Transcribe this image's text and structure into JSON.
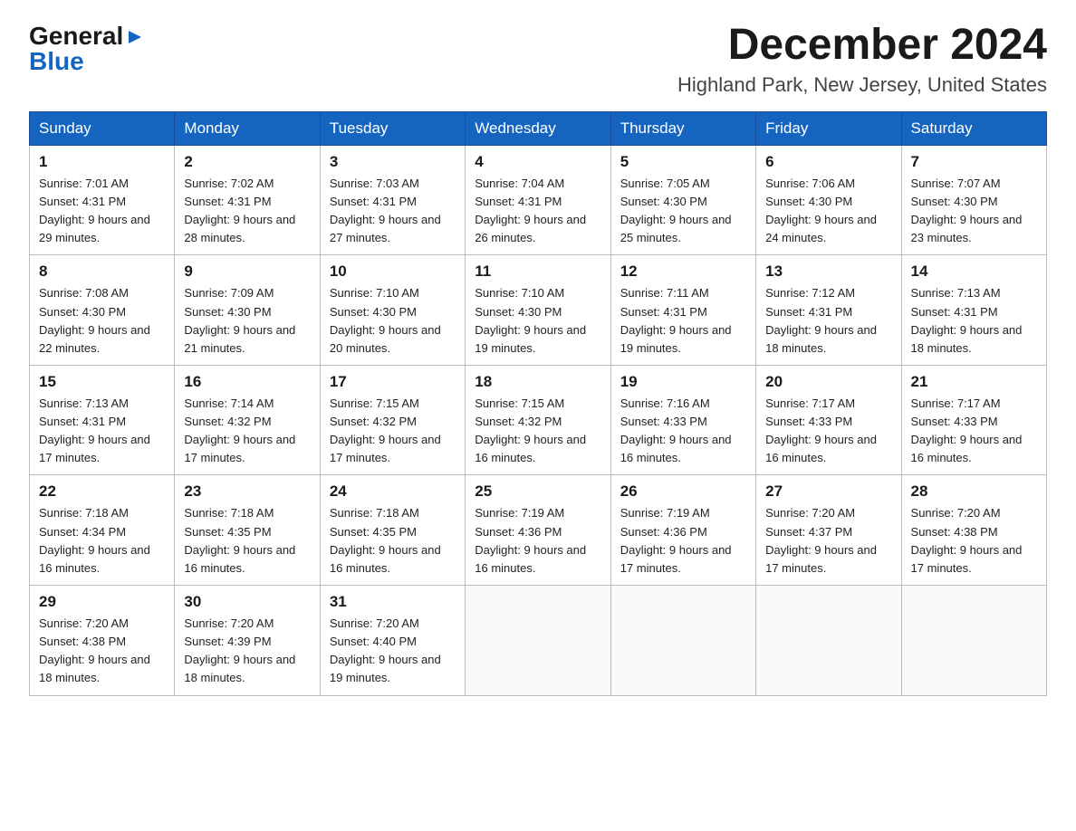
{
  "header": {
    "logo_general": "General",
    "logo_triangle": "▶",
    "logo_blue": "Blue",
    "month_title": "December 2024",
    "location": "Highland Park, New Jersey, United States"
  },
  "days_of_week": [
    "Sunday",
    "Monday",
    "Tuesday",
    "Wednesday",
    "Thursday",
    "Friday",
    "Saturday"
  ],
  "weeks": [
    [
      {
        "day": "1",
        "sunrise": "Sunrise: 7:01 AM",
        "sunset": "Sunset: 4:31 PM",
        "daylight": "Daylight: 9 hours and 29 minutes."
      },
      {
        "day": "2",
        "sunrise": "Sunrise: 7:02 AM",
        "sunset": "Sunset: 4:31 PM",
        "daylight": "Daylight: 9 hours and 28 minutes."
      },
      {
        "day": "3",
        "sunrise": "Sunrise: 7:03 AM",
        "sunset": "Sunset: 4:31 PM",
        "daylight": "Daylight: 9 hours and 27 minutes."
      },
      {
        "day": "4",
        "sunrise": "Sunrise: 7:04 AM",
        "sunset": "Sunset: 4:31 PM",
        "daylight": "Daylight: 9 hours and 26 minutes."
      },
      {
        "day": "5",
        "sunrise": "Sunrise: 7:05 AM",
        "sunset": "Sunset: 4:30 PM",
        "daylight": "Daylight: 9 hours and 25 minutes."
      },
      {
        "day": "6",
        "sunrise": "Sunrise: 7:06 AM",
        "sunset": "Sunset: 4:30 PM",
        "daylight": "Daylight: 9 hours and 24 minutes."
      },
      {
        "day": "7",
        "sunrise": "Sunrise: 7:07 AM",
        "sunset": "Sunset: 4:30 PM",
        "daylight": "Daylight: 9 hours and 23 minutes."
      }
    ],
    [
      {
        "day": "8",
        "sunrise": "Sunrise: 7:08 AM",
        "sunset": "Sunset: 4:30 PM",
        "daylight": "Daylight: 9 hours and 22 minutes."
      },
      {
        "day": "9",
        "sunrise": "Sunrise: 7:09 AM",
        "sunset": "Sunset: 4:30 PM",
        "daylight": "Daylight: 9 hours and 21 minutes."
      },
      {
        "day": "10",
        "sunrise": "Sunrise: 7:10 AM",
        "sunset": "Sunset: 4:30 PM",
        "daylight": "Daylight: 9 hours and 20 minutes."
      },
      {
        "day": "11",
        "sunrise": "Sunrise: 7:10 AM",
        "sunset": "Sunset: 4:30 PM",
        "daylight": "Daylight: 9 hours and 19 minutes."
      },
      {
        "day": "12",
        "sunrise": "Sunrise: 7:11 AM",
        "sunset": "Sunset: 4:31 PM",
        "daylight": "Daylight: 9 hours and 19 minutes."
      },
      {
        "day": "13",
        "sunrise": "Sunrise: 7:12 AM",
        "sunset": "Sunset: 4:31 PM",
        "daylight": "Daylight: 9 hours and 18 minutes."
      },
      {
        "day": "14",
        "sunrise": "Sunrise: 7:13 AM",
        "sunset": "Sunset: 4:31 PM",
        "daylight": "Daylight: 9 hours and 18 minutes."
      }
    ],
    [
      {
        "day": "15",
        "sunrise": "Sunrise: 7:13 AM",
        "sunset": "Sunset: 4:31 PM",
        "daylight": "Daylight: 9 hours and 17 minutes."
      },
      {
        "day": "16",
        "sunrise": "Sunrise: 7:14 AM",
        "sunset": "Sunset: 4:32 PM",
        "daylight": "Daylight: 9 hours and 17 minutes."
      },
      {
        "day": "17",
        "sunrise": "Sunrise: 7:15 AM",
        "sunset": "Sunset: 4:32 PM",
        "daylight": "Daylight: 9 hours and 17 minutes."
      },
      {
        "day": "18",
        "sunrise": "Sunrise: 7:15 AM",
        "sunset": "Sunset: 4:32 PM",
        "daylight": "Daylight: 9 hours and 16 minutes."
      },
      {
        "day": "19",
        "sunrise": "Sunrise: 7:16 AM",
        "sunset": "Sunset: 4:33 PM",
        "daylight": "Daylight: 9 hours and 16 minutes."
      },
      {
        "day": "20",
        "sunrise": "Sunrise: 7:17 AM",
        "sunset": "Sunset: 4:33 PM",
        "daylight": "Daylight: 9 hours and 16 minutes."
      },
      {
        "day": "21",
        "sunrise": "Sunrise: 7:17 AM",
        "sunset": "Sunset: 4:33 PM",
        "daylight": "Daylight: 9 hours and 16 minutes."
      }
    ],
    [
      {
        "day": "22",
        "sunrise": "Sunrise: 7:18 AM",
        "sunset": "Sunset: 4:34 PM",
        "daylight": "Daylight: 9 hours and 16 minutes."
      },
      {
        "day": "23",
        "sunrise": "Sunrise: 7:18 AM",
        "sunset": "Sunset: 4:35 PM",
        "daylight": "Daylight: 9 hours and 16 minutes."
      },
      {
        "day": "24",
        "sunrise": "Sunrise: 7:18 AM",
        "sunset": "Sunset: 4:35 PM",
        "daylight": "Daylight: 9 hours and 16 minutes."
      },
      {
        "day": "25",
        "sunrise": "Sunrise: 7:19 AM",
        "sunset": "Sunset: 4:36 PM",
        "daylight": "Daylight: 9 hours and 16 minutes."
      },
      {
        "day": "26",
        "sunrise": "Sunrise: 7:19 AM",
        "sunset": "Sunset: 4:36 PM",
        "daylight": "Daylight: 9 hours and 17 minutes."
      },
      {
        "day": "27",
        "sunrise": "Sunrise: 7:20 AM",
        "sunset": "Sunset: 4:37 PM",
        "daylight": "Daylight: 9 hours and 17 minutes."
      },
      {
        "day": "28",
        "sunrise": "Sunrise: 7:20 AM",
        "sunset": "Sunset: 4:38 PM",
        "daylight": "Daylight: 9 hours and 17 minutes."
      }
    ],
    [
      {
        "day": "29",
        "sunrise": "Sunrise: 7:20 AM",
        "sunset": "Sunset: 4:38 PM",
        "daylight": "Daylight: 9 hours and 18 minutes."
      },
      {
        "day": "30",
        "sunrise": "Sunrise: 7:20 AM",
        "sunset": "Sunset: 4:39 PM",
        "daylight": "Daylight: 9 hours and 18 minutes."
      },
      {
        "day": "31",
        "sunrise": "Sunrise: 7:20 AM",
        "sunset": "Sunset: 4:40 PM",
        "daylight": "Daylight: 9 hours and 19 minutes."
      },
      null,
      null,
      null,
      null
    ]
  ]
}
